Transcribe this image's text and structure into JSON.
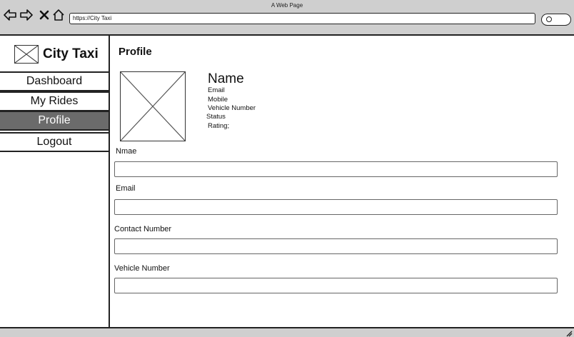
{
  "window": {
    "title": "A Web Page"
  },
  "browser": {
    "url": "https://City Taxi",
    "icons": [
      "back-icon",
      "forward-icon",
      "close-icon",
      "home-icon",
      "search-icon"
    ]
  },
  "sidebar": {
    "logo_text": "City Taxi",
    "items": [
      {
        "label": "Dashboard",
        "active": false
      },
      {
        "label": "My Rides",
        "active": false
      },
      {
        "label": "Profile",
        "active": true
      },
      {
        "label": "Logout",
        "active": false
      }
    ]
  },
  "main": {
    "page_title": "Profile",
    "profile": {
      "name": "Name",
      "info": [
        "Email",
        "Mobile",
        "Vehicle Number",
        "Status",
        "Rating;"
      ]
    },
    "form": {
      "fields": [
        {
          "label": "Nmae",
          "value": "",
          "placeholder": ""
        },
        {
          "label": "Email",
          "value": "",
          "placeholder": ""
        },
        {
          "label": "Contact Number",
          "value": "",
          "placeholder": ""
        },
        {
          "label": "Vehicle Number",
          "value": "",
          "placeholder": ""
        }
      ]
    }
  },
  "colors": {
    "chrome_bg": "#cfcfcf",
    "active_nav_bg": "#6b6b6b",
    "border": "#222222"
  }
}
